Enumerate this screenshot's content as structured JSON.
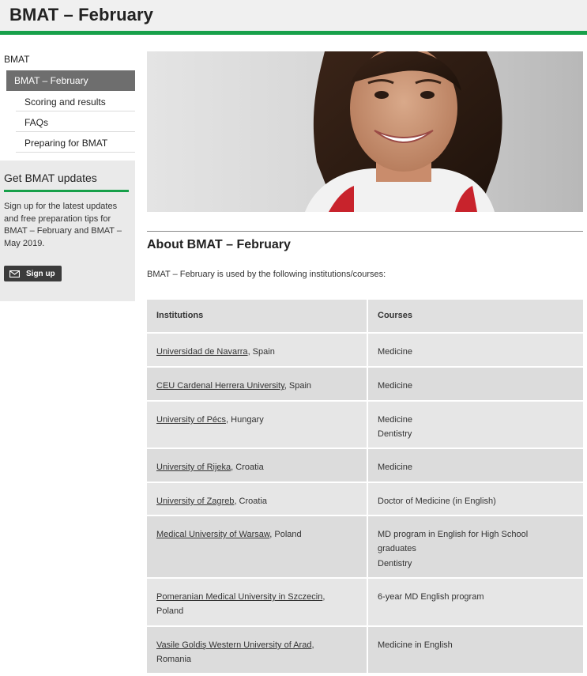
{
  "page_title": "BMAT – February",
  "sidebar": {
    "root_label": "BMAT",
    "active_label": "BMAT – February",
    "items": [
      {
        "label": "Scoring and results"
      },
      {
        "label": "FAQs"
      },
      {
        "label": "Preparing for BMAT"
      }
    ],
    "updates": {
      "heading": "Get BMAT updates",
      "text": "Sign up for the latest updates and free preparation tips for BMAT – February and BMAT – May 2019.",
      "button_label": "Sign up"
    }
  },
  "main": {
    "heading": "About BMAT – February",
    "intro": "BMAT – February is used by the following institutions/courses:",
    "table": {
      "headers": [
        "Institutions",
        "Courses"
      ],
      "rows": [
        {
          "institution": "Universidad de Navarra",
          "country": ", Spain",
          "courses": [
            "Medicine"
          ]
        },
        {
          "institution": "CEU Cardenal Herrera University",
          "country": ", Spain",
          "courses": [
            "Medicine"
          ]
        },
        {
          "institution": "University of Pécs",
          "country": ", Hungary",
          "courses": [
            "Medicine",
            "Dentistry"
          ]
        },
        {
          "institution": "University of Rijeka",
          "country": ", Croatia",
          "courses": [
            "Medicine"
          ]
        },
        {
          "institution": "University of Zagreb",
          "country": ", Croatia",
          "courses": [
            "Doctor of Medicine (in English)"
          ]
        },
        {
          "institution": "Medical University of Warsaw",
          "country": ", Poland",
          "courses": [
            "MD program in English for High School graduates",
            "Dentistry"
          ]
        },
        {
          "institution": "Pomeranian Medical University in Szczecin",
          "country": ", Poland",
          "courses": [
            "6-year MD English program"
          ]
        },
        {
          "institution": "Vasile Goldiş Western University of Arad",
          "country": ", Romania",
          "courses": [
            "Medicine in English"
          ]
        }
      ]
    }
  },
  "colors": {
    "accent_green": "#17a04a",
    "active_nav": "#6e6e6e",
    "button": "#3b3b3b"
  }
}
